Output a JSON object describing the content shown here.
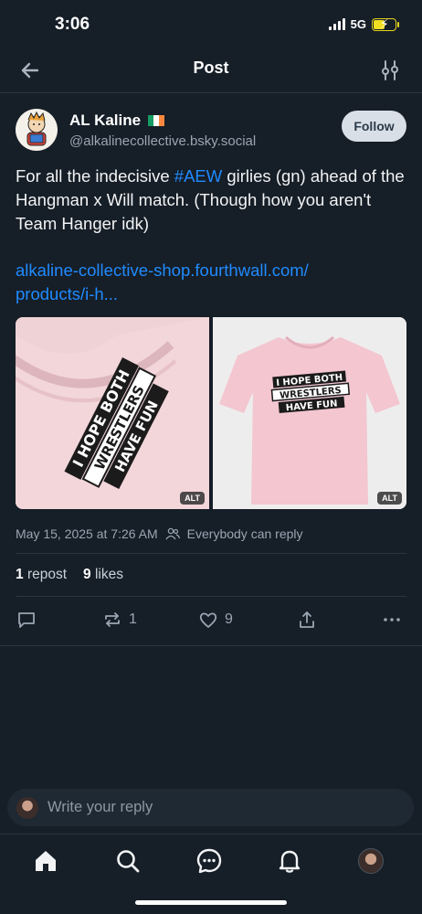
{
  "status_bar": {
    "time": "3:06",
    "network": "5G"
  },
  "header": {
    "title": "Post"
  },
  "post": {
    "author_name": "AL Kaline",
    "handle": "@alkalinecollective.bsky.social",
    "follow_label": "Follow",
    "text_before": "For all the indecisive ",
    "hashtag": "#AEW",
    "text_after": " girlies (gn) ahead of the Hangman x Will match. (Though how you aren't Team Hanger idk)",
    "link_line1": "alkaline-collective-shop.fourthwall.com/",
    "link_line2": "products/i-h...",
    "shirt_text": [
      "I HOPE BOTH",
      "WRESTLERS",
      "HAVE FUN"
    ],
    "alt_label": "ALT",
    "timestamp": "May 15, 2025 at 7:26 AM",
    "reply_setting": "Everybody can reply",
    "reposts_count": "1",
    "reposts_label": "repost",
    "likes_count": "9",
    "likes_label": "likes",
    "action_repost_count": "1",
    "action_like_count": "9"
  },
  "reply": {
    "placeholder": "Write your reply"
  },
  "icons": [
    "back-arrow-icon",
    "tune-icon",
    "comment-icon",
    "repost-icon",
    "heart-icon",
    "share-icon",
    "more-icon",
    "home-icon",
    "search-icon",
    "chat-icon",
    "bell-icon"
  ],
  "colors": {
    "background": "#161e27",
    "accent": "#208bfe",
    "muted": "#9aa6b3"
  }
}
